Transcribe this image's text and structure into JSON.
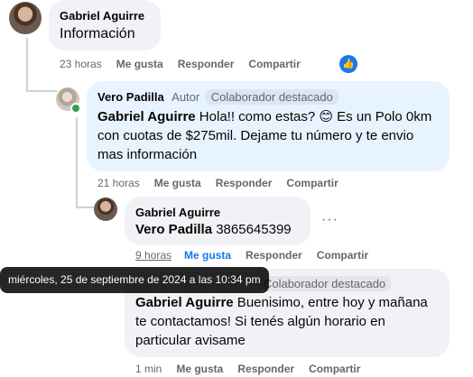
{
  "comment1": {
    "author": "Gabriel Aguirre",
    "text": "Información",
    "time": "23 horas",
    "like": "Me gusta",
    "reply": "Responder",
    "share": "Compartir",
    "reaction_icon": "thumbs-up-icon"
  },
  "comment2": {
    "author": "Vero Padilla",
    "badge_author": "Autor",
    "badge_top": "Colaborador destacado",
    "mention": "Gabriel Aguirre",
    "text": " Hola!! como estas? 😊 Es un Polo 0km con cuotas de $275mil. Dejame tu número y te envio mas información",
    "time": "21 horas",
    "like": "Me gusta",
    "reply": "Responder",
    "share": "Compartir"
  },
  "comment3": {
    "author": "Gabriel Aguirre",
    "mention": "Vero Padilla",
    "text": " 3865645399",
    "time": "9 horas",
    "like": "Me gusta",
    "reply": "Responder",
    "share": "Compartir"
  },
  "comment4": {
    "badge_top": "Colaborador destacado",
    "mention": "Gabriel Aguirre",
    "text": " Buenisimo, entre hoy y mañana te contactamos! Si tenés algún horario en particular avisame",
    "time": "1 min",
    "like": "Me gusta",
    "reply": "Responder",
    "share": "Compartir"
  },
  "tooltip": "miércoles, 25 de septiembre de 2024 a las 10:34 pm",
  "colors": {
    "accent": "#1877f2",
    "bubble": "#f0f2f5",
    "bubble_highlight": "#e7f3ff",
    "online": "#31a24c"
  }
}
